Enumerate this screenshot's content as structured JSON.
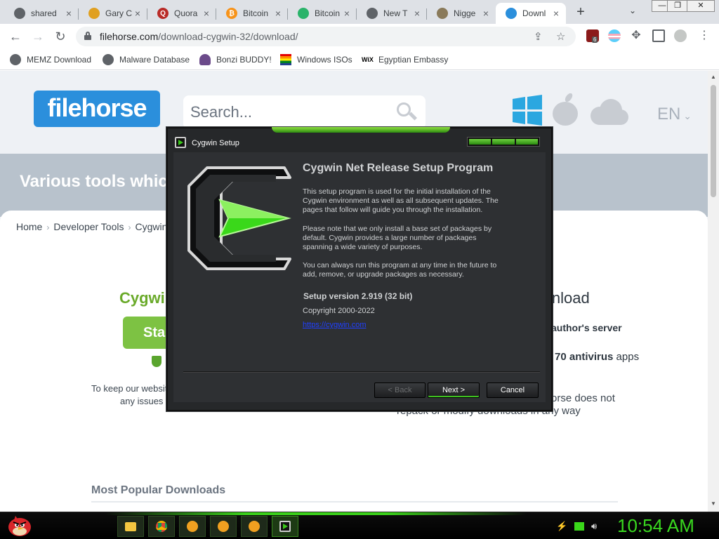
{
  "browser": {
    "tabs": [
      {
        "title": "shared",
        "favicon": "globe",
        "color": "#5f6368"
      },
      {
        "title": "Gary C",
        "favicon": "book",
        "color": "#e0a020"
      },
      {
        "title": "Quora",
        "favicon": "quora",
        "color": "#b92b27"
      },
      {
        "title": "Bitcoin",
        "favicon": "bitcoin",
        "color": "#f7931a"
      },
      {
        "title": "Bitcoin",
        "favicon": "grid",
        "color": "#2ab36a"
      },
      {
        "title": "New T",
        "favicon": "chrome",
        "color": "#5f6368"
      },
      {
        "title": "Nigge",
        "favicon": "image",
        "color": "#8a7a5a"
      },
      {
        "title": "Downl",
        "favicon": "filehorse",
        "color": "#2b8fdc"
      }
    ],
    "url_host": "filehorse.com",
    "url_path": "/download-cygwin-32/download/",
    "extension_badge": "6",
    "bookmarks": [
      {
        "label": "MEMZ Download",
        "icon": "globe-icon"
      },
      {
        "label": "Malware Database",
        "icon": "globe-icon"
      },
      {
        "label": "Bonzi BUDDY!",
        "icon": "bonzi-icon"
      },
      {
        "label": "Windows ISOs",
        "icon": "windows-rainbow-icon"
      },
      {
        "label": "Egyptian Embassy",
        "icon": "wix-icon"
      }
    ],
    "wix_text": "WiX"
  },
  "site": {
    "logo": "filehorse",
    "search_placeholder": "Search...",
    "language": "EN",
    "banner": "Various tools which",
    "breadcrumb": [
      "Home",
      "Developer Tools",
      "Cygwin"
    ],
    "download_title": "Cygwin",
    "start_label": "Star",
    "keep_line1": "To keep our websit",
    "keep_line2": "any issues",
    "right_title": "wnload",
    "right_author": "author's server",
    "right_av_count": "70 antivirus",
    "right_av_tail": " apps",
    "right_line1": "orse does not",
    "right_line2": "repack or modify downloads in any way",
    "popular": "Most Popular Downloads"
  },
  "dialog": {
    "title": "Cygwin Setup",
    "heading": "Cygwin Net Release Setup Program",
    "para1": [
      "This setup program is used for the initial installation of the",
      "Cygwin environment as well as all subsequent updates. The",
      "pages that follow will guide you through the installation."
    ],
    "para2": [
      "Please note that we only install a base set of packages by",
      "default.  Cygwin provides a large number of packages",
      "spanning a wide variety of purposes."
    ],
    "para3": [
      "You can always run this program at any time in the future to",
      "add, remove, or upgrade packages as necessary."
    ],
    "version": "Setup version 2.919 (32 bit)",
    "copyright": "Copyright 2000-2022",
    "link": "https://cygwin.com",
    "back": "< Back",
    "next": "Next >",
    "cancel": "Cancel"
  },
  "taskbar": {
    "clock": "10:54 AM",
    "accent": "#39d81f"
  }
}
